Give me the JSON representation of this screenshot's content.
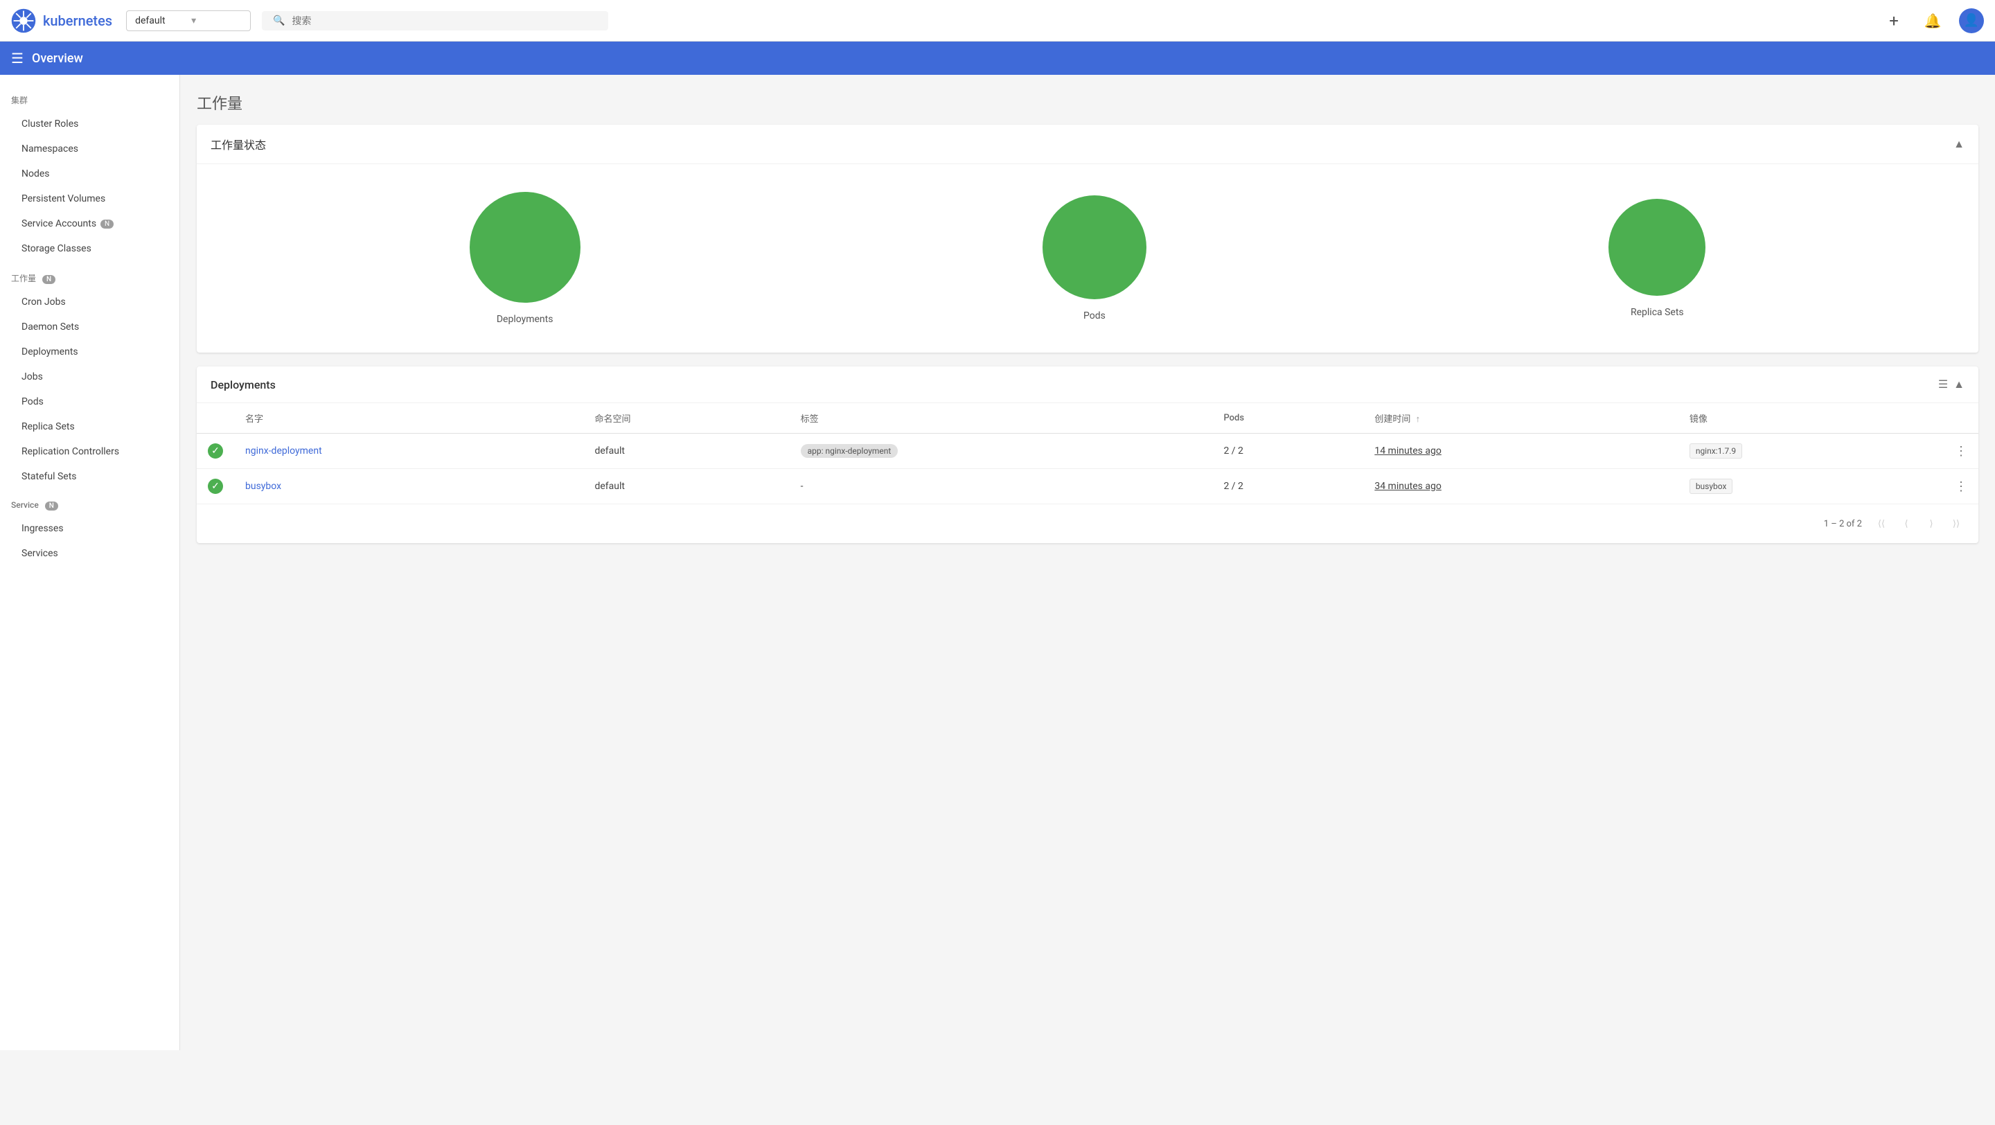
{
  "topbar": {
    "app_name": "kubernetes",
    "namespace": "default",
    "namespace_placeholder": "default",
    "search_placeholder": "搜索"
  },
  "section_bar": {
    "title": "Overview"
  },
  "sidebar": {
    "cluster_label": "集群",
    "cluster_items": [
      {
        "label": "Cluster Roles",
        "id": "cluster-roles"
      },
      {
        "label": "Namespaces",
        "id": "namespaces"
      },
      {
        "label": "Nodes",
        "id": "nodes"
      },
      {
        "label": "Persistent Volumes",
        "id": "persistent-volumes"
      },
      {
        "label": "Service Accounts",
        "id": "service-accounts",
        "badge": "N"
      },
      {
        "label": "Storage Classes",
        "id": "storage-classes"
      }
    ],
    "workload_label": "工作量",
    "workload_badge": "N",
    "workload_items": [
      {
        "label": "Cron Jobs",
        "id": "cron-jobs"
      },
      {
        "label": "Daemon Sets",
        "id": "daemon-sets"
      },
      {
        "label": "Deployments",
        "id": "deployments"
      },
      {
        "label": "Jobs",
        "id": "jobs"
      },
      {
        "label": "Pods",
        "id": "pods"
      },
      {
        "label": "Replica Sets",
        "id": "replica-sets"
      },
      {
        "label": "Replication Controllers",
        "id": "replication-controllers"
      },
      {
        "label": "Stateful Sets",
        "id": "stateful-sets"
      }
    ],
    "service_label": "Service",
    "service_badge": "N",
    "service_items": [
      {
        "label": "Ingresses",
        "id": "ingresses"
      },
      {
        "label": "Services",
        "id": "services"
      }
    ]
  },
  "main": {
    "page_title": "工作量",
    "workload_status_card": {
      "title": "工作量状态",
      "items": [
        {
          "label": "Deployments",
          "size": "lg"
        },
        {
          "label": "Pods",
          "size": "md"
        },
        {
          "label": "Replica Sets",
          "size": "sm"
        }
      ]
    },
    "deployments_card": {
      "title": "Deployments",
      "columns": [
        {
          "label": "名字",
          "id": "name"
        },
        {
          "label": "命名空间",
          "id": "namespace"
        },
        {
          "label": "标签",
          "id": "labels"
        },
        {
          "label": "Pods",
          "id": "pods"
        },
        {
          "label": "创建时间",
          "id": "created",
          "sortable": true
        },
        {
          "label": "镜像",
          "id": "image"
        }
      ],
      "rows": [
        {
          "name": "nginx-deployment",
          "namespace": "default",
          "labels": "app: nginx-deployment",
          "pods": "2 / 2",
          "created": "14 minutes ago",
          "image": "nginx:1.7.9",
          "status": "ok"
        },
        {
          "name": "busybox",
          "namespace": "default",
          "labels": "-",
          "pods": "2 / 2",
          "created": "34 minutes ago",
          "image": "busybox",
          "status": "ok"
        }
      ],
      "pagination": {
        "info": "1 – 2 of 2"
      }
    }
  }
}
